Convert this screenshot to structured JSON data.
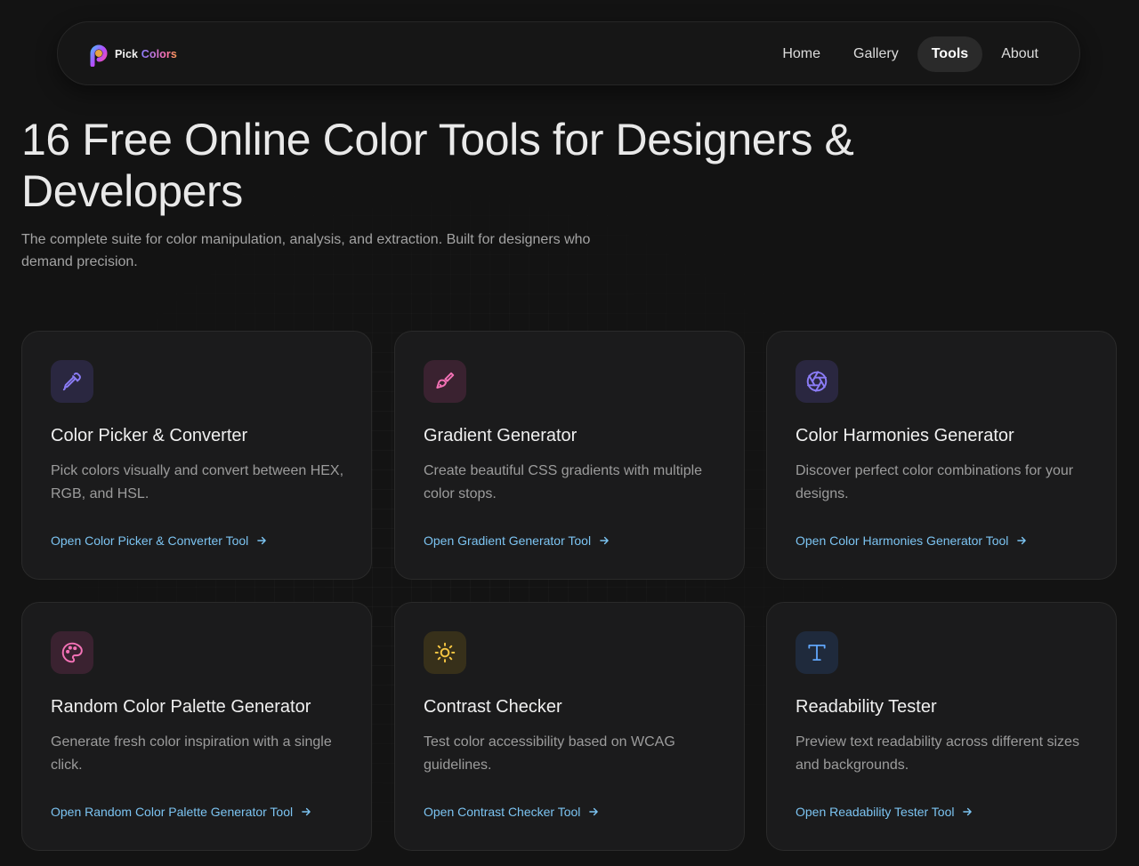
{
  "brand": {
    "name_part1": "Pick",
    "name_part2": "Colors"
  },
  "nav": {
    "items": [
      {
        "label": "Home",
        "active": false
      },
      {
        "label": "Gallery",
        "active": false
      },
      {
        "label": "Tools",
        "active": true
      },
      {
        "label": "About",
        "active": false
      }
    ]
  },
  "hero": {
    "title": "16 Free Online Color Tools for Designers & Developers",
    "subtitle": "The complete suite for color manipulation, analysis, and extraction. Built for designers who demand precision."
  },
  "tools": [
    {
      "title": "Color Picker & Converter",
      "description": "Pick colors visually and convert between HEX, RGB, and HSL.",
      "link": "Open Color Picker & Converter Tool",
      "icon": "eyedropper-icon",
      "icon_color": "#8b7cf6",
      "icon_bg": "#2a2740"
    },
    {
      "title": "Gradient Generator",
      "description": "Create beautiful CSS gradients with multiple color stops.",
      "link": "Open Gradient Generator Tool",
      "icon": "paintbrush-icon",
      "icon_color": "#f472b6",
      "icon_bg": "#3a2230"
    },
    {
      "title": "Color Harmonies Generator",
      "description": "Discover perfect color combinations for your designs.",
      "link": "Open Color Harmonies Generator Tool",
      "icon": "aperture-icon",
      "icon_color": "#8b7cf6",
      "icon_bg": "#2a2740"
    },
    {
      "title": "Random Color Palette Generator",
      "description": "Generate fresh color inspiration with a single click.",
      "link": "Open Random Color Palette Generator Tool",
      "icon": "palette-icon",
      "icon_color": "#f472b6",
      "icon_bg": "#3a2230"
    },
    {
      "title": "Contrast Checker",
      "description": "Test color accessibility based on WCAG guidelines.",
      "link": "Open Contrast Checker Tool",
      "icon": "sun-icon",
      "icon_color": "#f5c542",
      "icon_bg": "#37301a"
    },
    {
      "title": "Readability Tester",
      "description": "Preview text readability across different sizes and backgrounds.",
      "link": "Open Readability Tester Tool",
      "icon": "type-icon",
      "icon_color": "#60a5fa",
      "icon_bg": "#1f2a3c"
    }
  ],
  "colors": {
    "background": "#131313",
    "card": "#1b1b1c",
    "link": "#7cc4f2",
    "text_muted": "#9c9c9c"
  }
}
